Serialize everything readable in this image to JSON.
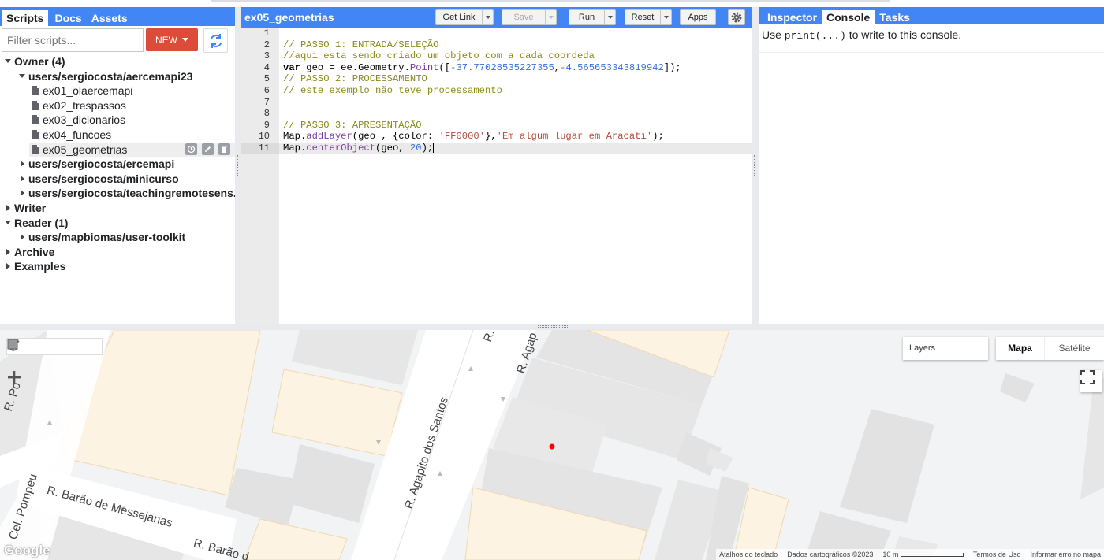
{
  "scripts_panel": {
    "tabs": [
      "Scripts",
      "Docs",
      "Assets"
    ],
    "filter_placeholder": "Filter scripts...",
    "new_label": "NEW",
    "tree": {
      "owner": "Owner (4)",
      "repo1": "users/sergiocosta/aercemapi23",
      "files": [
        "ex01_olaercemapi",
        "ex02_trespassos",
        "ex03_dicionarios",
        "ex04_funcoes",
        "ex05_geometrias"
      ],
      "repo2": "users/sergiocosta/ercemapi",
      "repo3": "users/sergiocosta/minicurso",
      "repo4": "users/sergiocosta/teachingremotesens...",
      "writer": "Writer",
      "reader": "Reader (1)",
      "reader_repo": "users/mapbiomas/user-toolkit",
      "archive": "Archive",
      "examples": "Examples"
    }
  },
  "editor": {
    "title": "ex05_geometrias",
    "get_link": "Get Link",
    "save": "Save",
    "run": "Run",
    "reset": "Reset",
    "apps": "Apps",
    "lines": [
      "",
      "// PASSO 1: ENTRADA/SELEÇÃO",
      "//aqui esta sendo criado um objeto com a dada coordeda",
      "var geo = ee.Geometry.Point([-37.77028535227355,-4.565653343819942]);",
      "// PASSO 2: PROCESSAMENTO",
      "// este exemplo não teve processamento",
      "",
      "",
      "// PASSO 3: APRESENTAÇÃO",
      "Map.addLayer(geo , {color: 'FF0000'},'Em algum lugar em Aracati');",
      "Map.centerObject(geo, 20);"
    ]
  },
  "right_panel": {
    "tabs": [
      "Inspector",
      "Console",
      "Tasks"
    ],
    "console_pre": "Use ",
    "console_code": "print(...)",
    "console_post": " to write to this console."
  },
  "map": {
    "layers_label": "Layers",
    "map_types": [
      "Mapa",
      "Satélite"
    ],
    "streets": [
      "R. Barão de Messejanas",
      "R. Barão d",
      "R. Agapito dos Santos",
      "R. Agap",
      "R.",
      "Cel. Pompeu",
      "R. Po"
    ],
    "attribution": {
      "shortcuts": "Atalhos do teclado",
      "data": "Dados cartográficos ©2023",
      "scale": "10 m",
      "terms": "Termos de Uso",
      "report": "Informar erro no mapa"
    },
    "logo": "Google",
    "point_color": "#ff0000"
  }
}
